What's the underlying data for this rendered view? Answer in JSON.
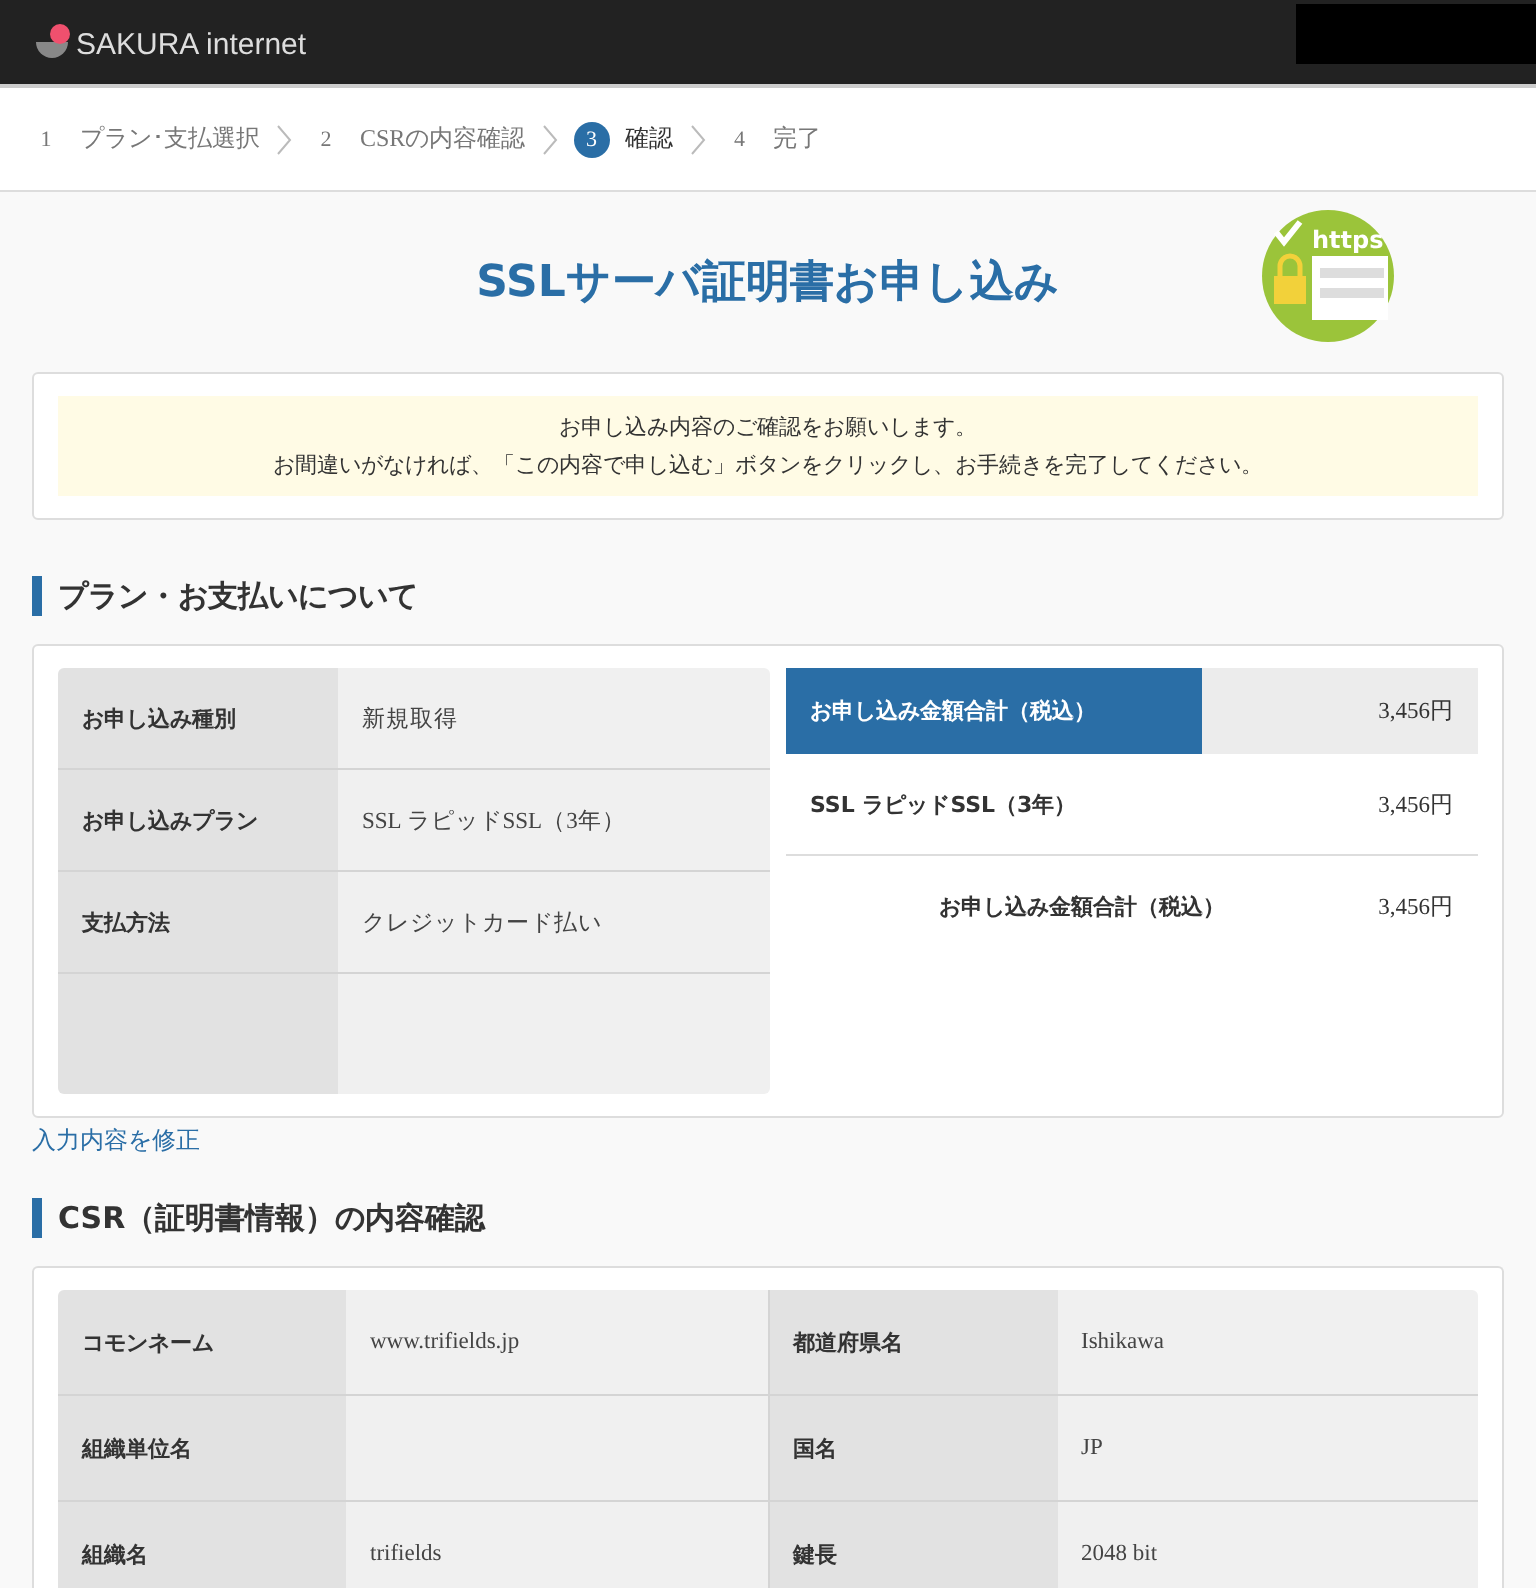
{
  "header": {
    "logo": "SAKURA internet"
  },
  "steps": [
    {
      "number": "1",
      "label": "プラン･支払選択",
      "selected": false
    },
    {
      "number": "2",
      "label": "CSRの内容確認",
      "selected": false
    },
    {
      "number": "3",
      "label": "確認",
      "selected": true
    },
    {
      "number": "4",
      "label": "完了",
      "selected": false
    }
  ],
  "page_title": "SSLサーバ証明書お申し込み",
  "badge_text": "https",
  "notice": [
    "お申し込み内容のご確認をお願いします。",
    "お間違いがなければ、「この内容で申し込む」ボタンをクリックし、お手続きを完了してください。"
  ],
  "plan_section": {
    "heading": "プラン・お支払いについて",
    "rows": [
      {
        "label": "お申し込み種別",
        "value": "新規取得"
      },
      {
        "label": "お申し込みプラン",
        "value": "SSL ラピッドSSL（3年）"
      },
      {
        "label": "支払方法",
        "value": "クレジットカード払い"
      },
      {
        "label": "",
        "value": ""
      }
    ],
    "summary_header": {
      "label": "お申し込み金額合計（税込）",
      "amount": "3,456円"
    },
    "summary_items": [
      {
        "label": "SSL ラピッドSSL（3年）",
        "amount": "3,456円"
      }
    ],
    "summary_total": {
      "label": "お申し込み金額合計（税込）",
      "amount": "3,456円"
    }
  },
  "edit_link": "入力内容を修正",
  "csr_section": {
    "heading": "CSR（証明書情報）の内容確認",
    "rows": [
      {
        "label": "コモンネーム",
        "value": "www.trifields.jp",
        "label_2": "都道府県名",
        "value_2": "Ishikawa"
      },
      {
        "label": "組織単位名",
        "value": "",
        "label_2": "国名",
        "value_2": "JP"
      },
      {
        "label": "組織名",
        "value": "trifields",
        "label_2": "鍵長",
        "value_2": "2048 bit"
      }
    ]
  }
}
